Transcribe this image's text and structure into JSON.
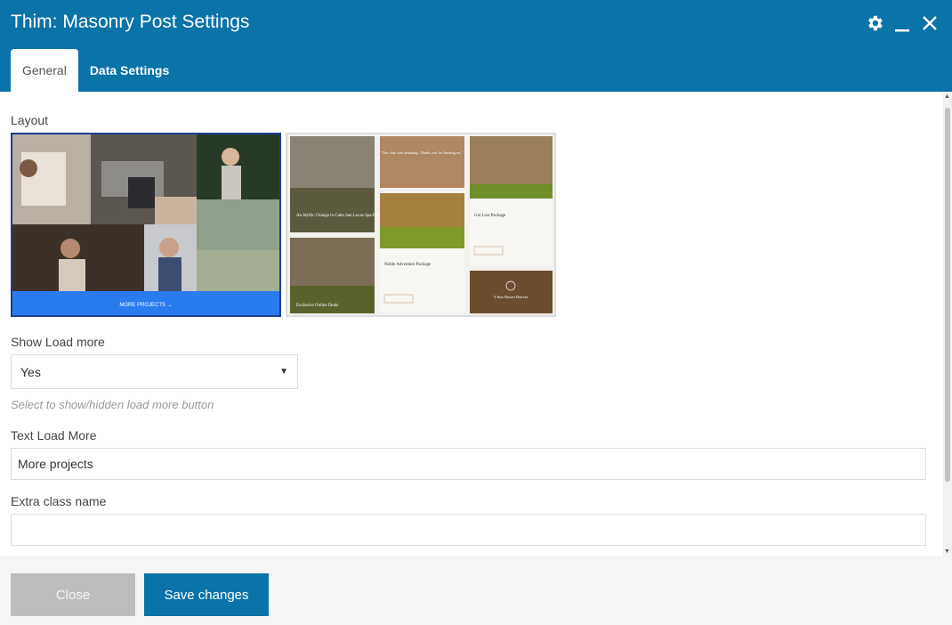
{
  "window": {
    "title": "Thim: Masonry Post Settings",
    "icons": [
      "gear-icon",
      "minimize-icon",
      "close-icon"
    ]
  },
  "tabs": [
    {
      "label": "General",
      "active": true
    },
    {
      "label": "Data Settings",
      "active": false
    }
  ],
  "form": {
    "layout_label": "Layout",
    "layouts": [
      {
        "name": "layout-1",
        "selected": true,
        "more_text": "MORE PROJECTS →"
      },
      {
        "name": "layout-2",
        "selected": false,
        "cards": [
          "An Idyllic Change in Cabo San Lucas Spa Resorts",
          "\"Our stay was amazing. Thank you for hosting us.\"",
          "Get Lost Package",
          "Noble Adventure Package",
          "Exclusive Online Deals",
          "5-Star Resort Retreat"
        ]
      }
    ],
    "load_more_label": "Show Load more",
    "load_more_value": "Yes",
    "load_more_help": "Select to show/hidden load more button",
    "text_load_more_label": "Text Load More",
    "text_load_more_value": "More projects",
    "extra_class_label": "Extra class name",
    "extra_class_value": ""
  },
  "footer": {
    "close_label": "Close",
    "save_label": "Save changes"
  },
  "colors": {
    "header": "#0a73a8",
    "save_button": "#0a73a8",
    "close_button": "#bdbdbd",
    "selected_border": "#1a3f8e",
    "more_bar": "#2b7bf0"
  }
}
